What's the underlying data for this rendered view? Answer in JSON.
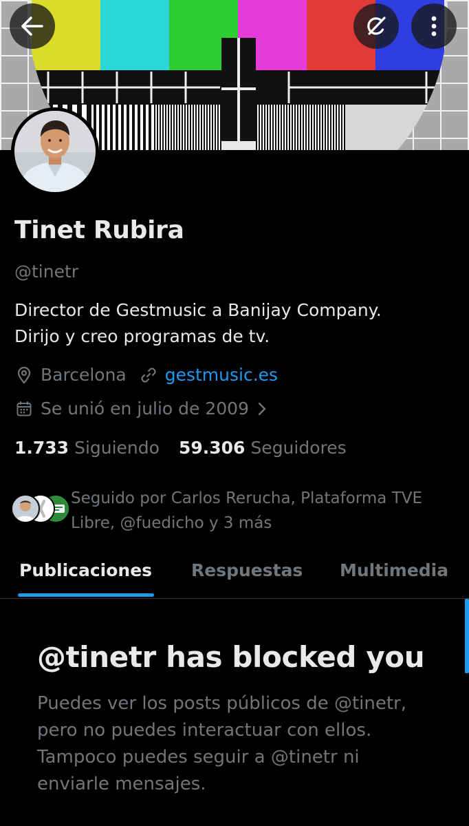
{
  "header": {
    "back_icon": "arrow-left-icon",
    "grok_icon": "grok-icon",
    "more_icon": "more-vertical-icon"
  },
  "profile": {
    "name": "Tinet Rubira",
    "handle": "@tinetr",
    "bio_lines": [
      "Director de Gestmusic a Banijay Company.",
      "Dirijo y creo programas de tv."
    ],
    "location": "Barcelona",
    "website": "gestmusic.es",
    "joined": "Se unió en julio de 2009",
    "following_count": "1.733",
    "following_label": "Siguiendo",
    "followers_count": "59.306",
    "followers_label": "Seguidores"
  },
  "followed_by": {
    "lines": [
      "Seguido por Carlos Rerucha, Plataforma TVE",
      "Libre, @fuedicho y 3 más"
    ]
  },
  "tabs": [
    {
      "label": "Publicaciones",
      "active": true
    },
    {
      "label": "Respuestas",
      "active": false
    },
    {
      "label": "Multimedia",
      "active": false
    }
  ],
  "blocked": {
    "title": "@tinetr has blocked you",
    "message_lines": [
      "Puedes ver los posts públicos de @tinetr,",
      "pero no puedes interactuar con ellos.",
      "Tampoco puedes seguir a @tinetr ni",
      "enviarle mensajes."
    ]
  },
  "colors": {
    "background": "#000000",
    "primary_text": "#e7e9ea",
    "secondary_text": "#71767b",
    "accent": "#1d9bf0",
    "divider": "#2f3336"
  }
}
